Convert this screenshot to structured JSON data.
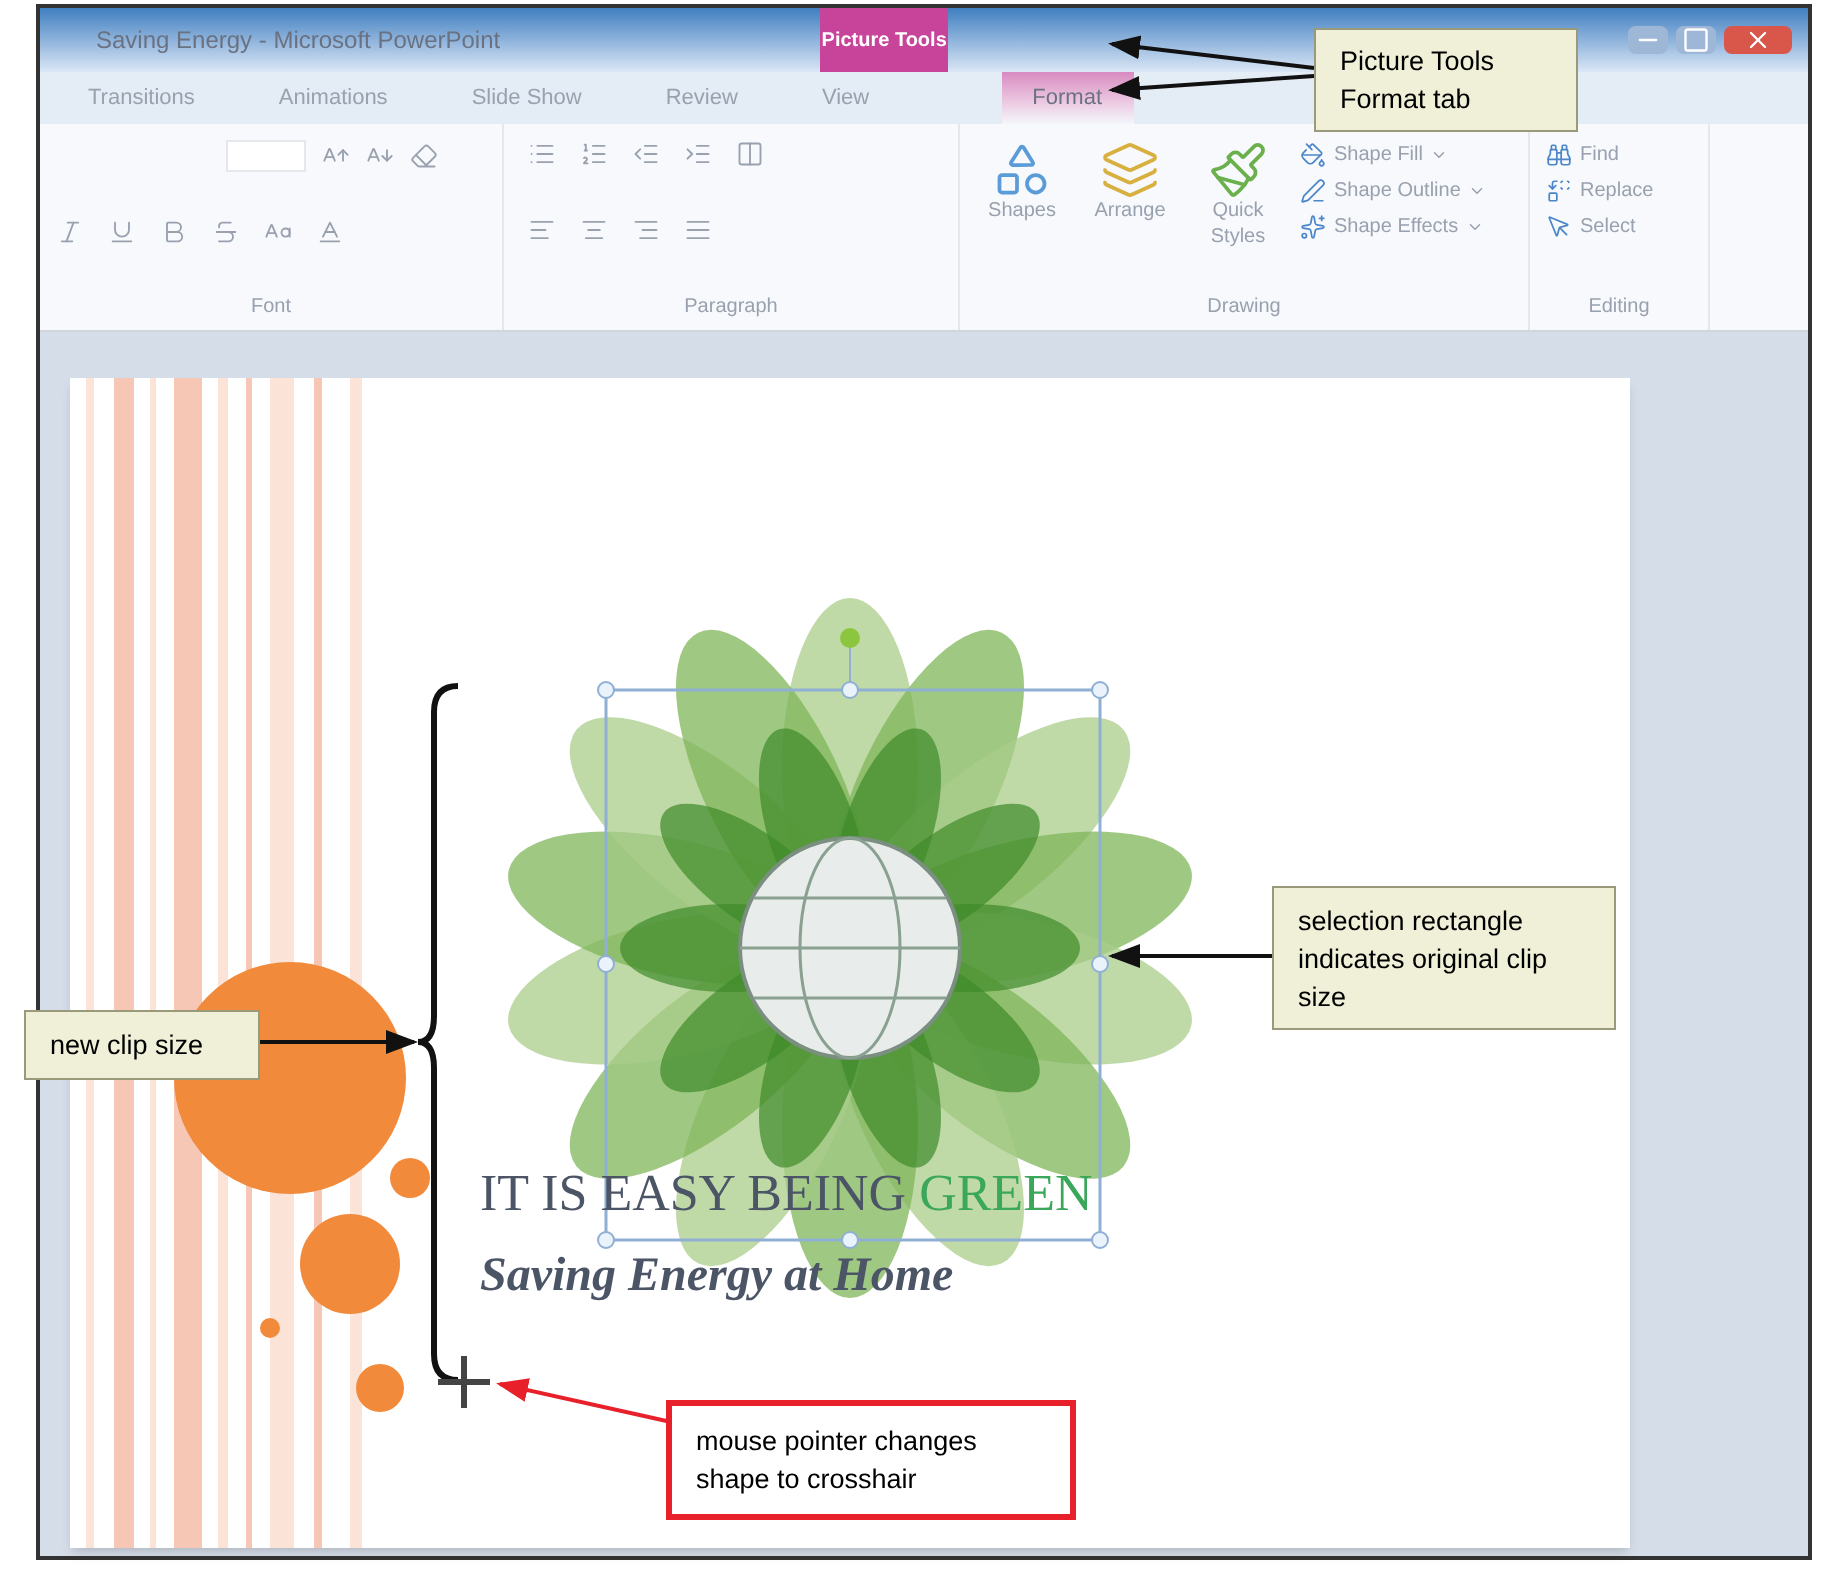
{
  "window": {
    "title": "Saving Energy - Microsoft PowerPoint",
    "context_group": "Picture Tools"
  },
  "tabs": [
    {
      "label": "Transitions",
      "selected": false
    },
    {
      "label": "Animations",
      "selected": false
    },
    {
      "label": "Slide Show",
      "selected": false
    },
    {
      "label": "Review",
      "selected": false
    },
    {
      "label": "View",
      "selected": false
    },
    {
      "label": "Format",
      "selected": true
    }
  ],
  "ribbon": {
    "groups": [
      {
        "kind": "font",
        "label": "Font"
      },
      {
        "kind": "paragraph",
        "label": "Paragraph"
      },
      {
        "kind": "drawing",
        "label": "Drawing",
        "large_buttons": [
          "Shapes",
          "Arrange",
          "Quick Styles"
        ],
        "small_buttons": [
          "Shape Fill",
          "Shape Outline",
          "Shape Effects"
        ]
      },
      {
        "kind": "editing",
        "label": "Editing",
        "small_buttons": [
          "Find",
          "Replace",
          "Select"
        ]
      }
    ]
  },
  "slide": {
    "title_parts": [
      {
        "text": "IT IS EASY BEING ",
        "color": "#4b5566"
      },
      {
        "text": "GREEN",
        "color": "#3aa75a"
      }
    ],
    "subtitle": "Saving Energy at Home"
  },
  "callouts": [
    {
      "kind": "plain",
      "text": "Picture Tools Format tab"
    },
    {
      "kind": "plain",
      "text": "selection rectangle indicates original clip size"
    },
    {
      "kind": "plain",
      "text": "new clip size"
    },
    {
      "kind": "highlight",
      "text": "mouse pointer changes shape to crosshair"
    }
  ]
}
